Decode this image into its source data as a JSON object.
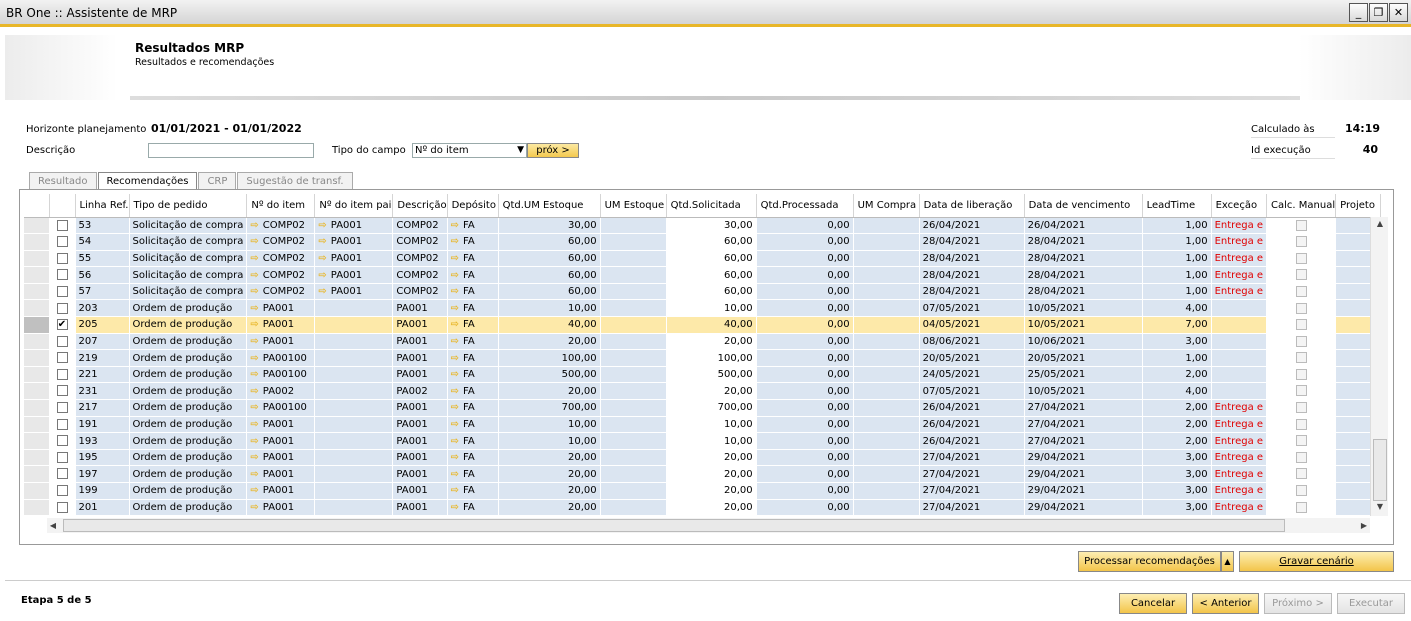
{
  "window": {
    "title": "BR One :: Assistente de MRP",
    "minimize": "_",
    "restore": "❐",
    "close": "✕"
  },
  "header": {
    "title": "Resultados MRP",
    "subtitle": "Resultados e recomendações"
  },
  "form": {
    "horizonte_label": "Horizonte planejamento",
    "horizonte_value": "01/01/2021 - 01/01/2022",
    "descricao_label": "Descrição",
    "descricao_value": "",
    "tipo_campo_label": "Tipo do campo",
    "tipo_campo_value": "Nº do item",
    "prox_label": "próx >",
    "calculado_label": "Calculado às",
    "calculado_value": "14:19",
    "id_exec_label": "Id execução",
    "id_exec_value": "40"
  },
  "tabs": [
    "Resultado",
    "Recomendações",
    "CRP",
    "Sugestão de transf."
  ],
  "active_tab": 1,
  "columns": [
    "",
    "",
    "Linha Ref.",
    "Tipo de pedido",
    "Nº do item",
    "Nº do item pai",
    "Descrição",
    "Depósito",
    "Qtd.UM Estoque",
    "UM Estoque",
    "Qtd.Solicitada",
    "Qtd.Processada",
    "UM Compra",
    "Data de liberação",
    "Data de vencimento",
    "LeadTime",
    "Exceção",
    "Calc. Manual",
    "Projeto"
  ],
  "rows": [
    {
      "checked": false,
      "ref": "53",
      "tipo": "Solicitação de compra",
      "item": "COMP02",
      "pai": "PA001",
      "desc": "COMP02",
      "dep": "FA",
      "qtd_um": "30,00",
      "sol": "30,00",
      "proc": "0,00",
      "lib": "26/04/2021",
      "venc": "26/04/2021",
      "lead": "1,00",
      "exc": "Entrega e"
    },
    {
      "checked": false,
      "ref": "54",
      "tipo": "Solicitação de compra",
      "item": "COMP02",
      "pai": "PA001",
      "desc": "COMP02",
      "dep": "FA",
      "qtd_um": "60,00",
      "sol": "60,00",
      "proc": "0,00",
      "lib": "28/04/2021",
      "venc": "28/04/2021",
      "lead": "1,00",
      "exc": "Entrega e"
    },
    {
      "checked": false,
      "ref": "55",
      "tipo": "Solicitação de compra",
      "item": "COMP02",
      "pai": "PA001",
      "desc": "COMP02",
      "dep": "FA",
      "qtd_um": "60,00",
      "sol": "60,00",
      "proc": "0,00",
      "lib": "28/04/2021",
      "venc": "28/04/2021",
      "lead": "1,00",
      "exc": "Entrega e"
    },
    {
      "checked": false,
      "ref": "56",
      "tipo": "Solicitação de compra",
      "item": "COMP02",
      "pai": "PA001",
      "desc": "COMP02",
      "dep": "FA",
      "qtd_um": "60,00",
      "sol": "60,00",
      "proc": "0,00",
      "lib": "28/04/2021",
      "venc": "28/04/2021",
      "lead": "1,00",
      "exc": "Entrega e"
    },
    {
      "checked": false,
      "ref": "57",
      "tipo": "Solicitação de compra",
      "item": "COMP02",
      "pai": "PA001",
      "desc": "COMP02",
      "dep": "FA",
      "qtd_um": "60,00",
      "sol": "60,00",
      "proc": "0,00",
      "lib": "28/04/2021",
      "venc": "28/04/2021",
      "lead": "1,00",
      "exc": "Entrega e"
    },
    {
      "checked": false,
      "ref": "203",
      "tipo": "Ordem de produção",
      "item": "PA001",
      "pai": "",
      "desc": "PA001",
      "dep": "FA",
      "qtd_um": "10,00",
      "sol": "10,00",
      "proc": "0,00",
      "lib": "07/05/2021",
      "venc": "10/05/2021",
      "lead": "4,00",
      "exc": ""
    },
    {
      "checked": true,
      "ref": "205",
      "tipo": "Ordem de produção",
      "item": "PA001",
      "pai": "",
      "desc": "PA001",
      "dep": "FA",
      "qtd_um": "40,00",
      "sol": "40,00",
      "proc": "0,00",
      "lib": "04/05/2021",
      "venc": "10/05/2021",
      "lead": "7,00",
      "exc": ""
    },
    {
      "checked": false,
      "ref": "207",
      "tipo": "Ordem de produção",
      "item": "PA001",
      "pai": "",
      "desc": "PA001",
      "dep": "FA",
      "qtd_um": "20,00",
      "sol": "20,00",
      "proc": "0,00",
      "lib": "08/06/2021",
      "venc": "10/06/2021",
      "lead": "3,00",
      "exc": ""
    },
    {
      "checked": false,
      "ref": "219",
      "tipo": "Ordem de produção",
      "item": "PA00100",
      "pai": "",
      "desc": "PA001",
      "dep": "FA",
      "qtd_um": "100,00",
      "sol": "100,00",
      "proc": "0,00",
      "lib": "20/05/2021",
      "venc": "20/05/2021",
      "lead": "1,00",
      "exc": ""
    },
    {
      "checked": false,
      "ref": "221",
      "tipo": "Ordem de produção",
      "item": "PA00100",
      "pai": "",
      "desc": "PA001",
      "dep": "FA",
      "qtd_um": "500,00",
      "sol": "500,00",
      "proc": "0,00",
      "lib": "24/05/2021",
      "venc": "25/05/2021",
      "lead": "2,00",
      "exc": ""
    },
    {
      "checked": false,
      "ref": "231",
      "tipo": "Ordem de produção",
      "item": "PA002",
      "pai": "",
      "desc": "PA002",
      "dep": "FA",
      "qtd_um": "20,00",
      "sol": "20,00",
      "proc": "0,00",
      "lib": "07/05/2021",
      "venc": "10/05/2021",
      "lead": "4,00",
      "exc": ""
    },
    {
      "checked": false,
      "ref": "217",
      "tipo": "Ordem de produção",
      "item": "PA00100",
      "pai": "",
      "desc": "PA001",
      "dep": "FA",
      "qtd_um": "700,00",
      "sol": "700,00",
      "proc": "0,00",
      "lib": "26/04/2021",
      "venc": "27/04/2021",
      "lead": "2,00",
      "exc": "Entrega e"
    },
    {
      "checked": false,
      "ref": "191",
      "tipo": "Ordem de produção",
      "item": "PA001",
      "pai": "",
      "desc": "PA001",
      "dep": "FA",
      "qtd_um": "10,00",
      "sol": "10,00",
      "proc": "0,00",
      "lib": "26/04/2021",
      "venc": "27/04/2021",
      "lead": "2,00",
      "exc": "Entrega e"
    },
    {
      "checked": false,
      "ref": "193",
      "tipo": "Ordem de produção",
      "item": "PA001",
      "pai": "",
      "desc": "PA001",
      "dep": "FA",
      "qtd_um": "10,00",
      "sol": "10,00",
      "proc": "0,00",
      "lib": "26/04/2021",
      "venc": "27/04/2021",
      "lead": "2,00",
      "exc": "Entrega e"
    },
    {
      "checked": false,
      "ref": "195",
      "tipo": "Ordem de produção",
      "item": "PA001",
      "pai": "",
      "desc": "PA001",
      "dep": "FA",
      "qtd_um": "20,00",
      "sol": "20,00",
      "proc": "0,00",
      "lib": "27/04/2021",
      "venc": "29/04/2021",
      "lead": "3,00",
      "exc": "Entrega e"
    },
    {
      "checked": false,
      "ref": "197",
      "tipo": "Ordem de produção",
      "item": "PA001",
      "pai": "",
      "desc": "PA001",
      "dep": "FA",
      "qtd_um": "20,00",
      "sol": "20,00",
      "proc": "0,00",
      "lib": "27/04/2021",
      "venc": "29/04/2021",
      "lead": "3,00",
      "exc": "Entrega e"
    },
    {
      "checked": false,
      "ref": "199",
      "tipo": "Ordem de produção",
      "item": "PA001",
      "pai": "",
      "desc": "PA001",
      "dep": "FA",
      "qtd_um": "20,00",
      "sol": "20,00",
      "proc": "0,00",
      "lib": "27/04/2021",
      "venc": "29/04/2021",
      "lead": "3,00",
      "exc": "Entrega e"
    },
    {
      "checked": false,
      "ref": "201",
      "tipo": "Ordem de produção",
      "item": "PA001",
      "pai": "",
      "desc": "PA001",
      "dep": "FA",
      "qtd_um": "20,00",
      "sol": "20,00",
      "proc": "0,00",
      "lib": "27/04/2021",
      "venc": "29/04/2021",
      "lead": "3,00",
      "exc": "Entrega e"
    }
  ],
  "highlight_row": 6,
  "buttons": {
    "processar": "Processar recomendações",
    "gravar": "Gravar cenário",
    "cancelar": "Cancelar",
    "anterior": "< Anterior",
    "proximo": "Próximo >",
    "executar": "Executar"
  },
  "step": "Etapa 5 de 5",
  "icons": {
    "arrow": "link-arrow-icon",
    "accent": "#e8b628"
  }
}
